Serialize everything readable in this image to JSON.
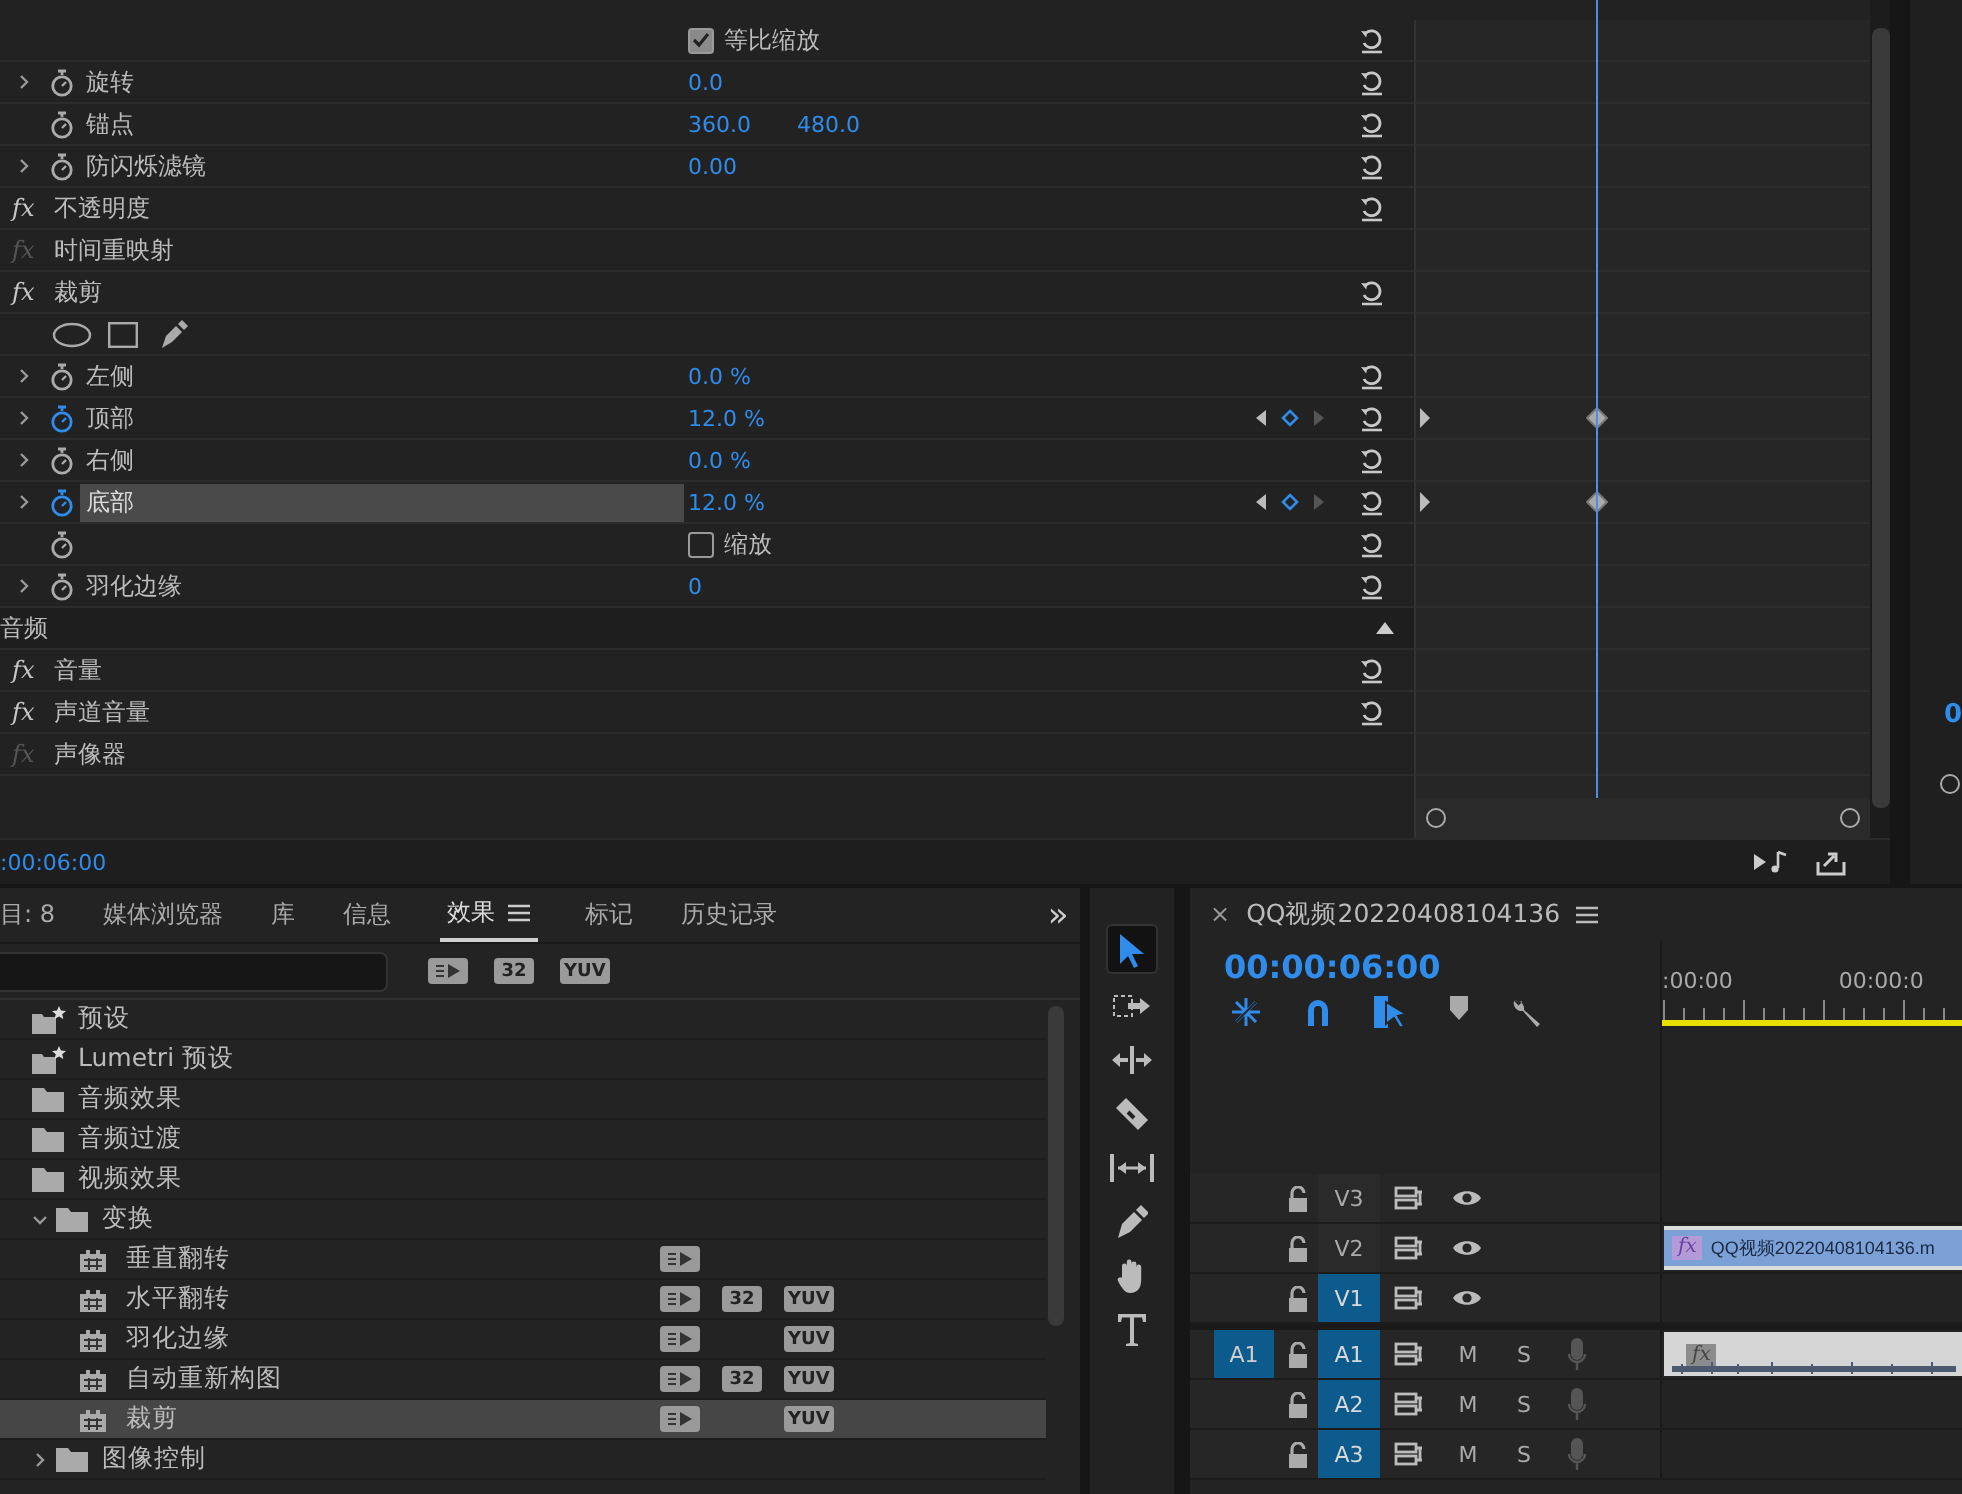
{
  "effect_controls": {
    "rows": [
      {
        "kind": "checkbox",
        "label": "等比缩放",
        "checked": true,
        "resettable": true
      },
      {
        "kind": "property",
        "label": "旋转",
        "values": [
          "0.0"
        ],
        "expanded": false,
        "animated": false,
        "keyframed": false,
        "selected": false,
        "resettable": true
      },
      {
        "kind": "property",
        "label": "锚点",
        "values": [
          "360.0",
          "480.0"
        ],
        "animated": false,
        "keyframed": false,
        "selected": false,
        "resettable": true
      },
      {
        "kind": "property",
        "label": "防闪烁滤镜",
        "values": [
          "0.00"
        ],
        "expanded": false,
        "animated": false,
        "keyframed": false,
        "selected": false,
        "resettable": true
      },
      {
        "kind": "effect",
        "icon_text": "fx",
        "label": "不透明度",
        "enabled": true,
        "resettable": true
      },
      {
        "kind": "effect",
        "icon_text": "fx",
        "label": "时间重映射",
        "enabled": false,
        "resettable": false
      },
      {
        "kind": "effect",
        "icon_text": "fx",
        "label": "裁剪",
        "enabled": true,
        "resettable": true
      },
      {
        "kind": "mask_tools"
      },
      {
        "kind": "property",
        "label": "左侧",
        "values": [
          "0.0 %"
        ],
        "expanded": false,
        "animated": false,
        "keyframed": false,
        "selected": false,
        "resettable": true
      },
      {
        "kind": "property",
        "label": "顶部",
        "values": [
          "12.0 %"
        ],
        "expanded": false,
        "animated": true,
        "keyframed": true,
        "selected": false,
        "resettable": true
      },
      {
        "kind": "property",
        "label": "右侧",
        "values": [
          "0.0 %"
        ],
        "expanded": false,
        "animated": false,
        "keyframed": false,
        "selected": false,
        "resettable": true
      },
      {
        "kind": "property",
        "label": "底部",
        "values": [
          "12.0 %"
        ],
        "expanded": false,
        "animated": true,
        "keyframed": true,
        "selected": true,
        "resettable": true
      },
      {
        "kind": "checkbox",
        "label": "缩放",
        "checked": false,
        "stopwatch": true,
        "resettable": true
      },
      {
        "kind": "property",
        "label": "羽化边缘",
        "values": [
          "0"
        ],
        "expanded": false,
        "animated": false,
        "keyframed": false,
        "selected": false,
        "resettable": true
      },
      {
        "kind": "section",
        "label": "音频",
        "expanded": true
      },
      {
        "kind": "effect",
        "icon_text": "fx",
        "label": "音量",
        "enabled": true,
        "resettable": true
      },
      {
        "kind": "effect",
        "icon_text": "fx",
        "label": "声道音量",
        "enabled": true,
        "resettable": true
      },
      {
        "kind": "effect",
        "icon_text": "fx",
        "label": "声像器",
        "enabled": false,
        "resettable": false
      }
    ],
    "timecode": ":00:06:00"
  },
  "program_monitor": {
    "timecode": "0"
  },
  "effects_panel": {
    "tabs": [
      {
        "label": "目: 8",
        "selected": false
      },
      {
        "label": "媒体浏览器",
        "selected": false
      },
      {
        "label": "库",
        "selected": false
      },
      {
        "label": "信息",
        "selected": false
      },
      {
        "label": "效果",
        "selected": true
      },
      {
        "label": "标记",
        "selected": false
      },
      {
        "label": "历史记录",
        "selected": false
      }
    ],
    "overflow": "»",
    "filters": [
      {
        "kind": "accelerated"
      },
      {
        "kind": "text",
        "label": "32"
      },
      {
        "kind": "text",
        "label": "YUV"
      }
    ],
    "tree": [
      {
        "kind": "preset",
        "label": "预设",
        "selected": false
      },
      {
        "kind": "preset",
        "label": "Lumetri 预设",
        "selected": false
      },
      {
        "kind": "folder",
        "label": "音频效果",
        "selected": false
      },
      {
        "kind": "folder",
        "label": "音频过渡",
        "selected": false
      },
      {
        "kind": "folder",
        "label": "视频效果",
        "selected": false,
        "expanded": true,
        "children": [
          {
            "kind": "folder",
            "label": "变换",
            "selected": false,
            "expanded": true,
            "children": [
              {
                "kind": "effect",
                "label": "垂直翻转",
                "selected": false,
                "accelerated": true
              },
              {
                "kind": "effect",
                "label": "水平翻转",
                "selected": false,
                "accelerated": true,
                "bit32": "32",
                "yuv": "YUV"
              },
              {
                "kind": "effect",
                "label": "羽化边缘",
                "selected": false,
                "accelerated": true,
                "yuv": "YUV"
              },
              {
                "kind": "effect",
                "label": "自动重新构图",
                "selected": false,
                "accelerated": true,
                "bit32": "32",
                "yuv": "YUV"
              },
              {
                "kind": "effect",
                "label": "裁剪",
                "selected": true,
                "accelerated": true,
                "yuv": "YUV"
              }
            ]
          },
          {
            "kind": "folder",
            "label": "图像控制",
            "selected": false,
            "expanded": false
          }
        ]
      }
    ]
  },
  "tools": [
    {
      "kind": "selection",
      "selected": true
    },
    {
      "kind": "track_select",
      "selected": false
    },
    {
      "kind": "ripple",
      "selected": false
    },
    {
      "kind": "razor",
      "selected": false
    },
    {
      "kind": "slip",
      "selected": false
    },
    {
      "kind": "pen",
      "selected": false
    },
    {
      "kind": "hand",
      "selected": false
    },
    {
      "kind": "type",
      "selected": false
    }
  ],
  "timeline": {
    "close": "×",
    "title": "QQ视频20220408104136",
    "timecode": "00:00:06:00",
    "controls": [
      {
        "kind": "nest",
        "on": true
      },
      {
        "kind": "snap",
        "on": true
      },
      {
        "kind": "linked",
        "on": true
      },
      {
        "kind": "marker"
      },
      {
        "kind": "settings"
      }
    ],
    "ruler": [
      ":00:00",
      "00:00:0"
    ],
    "video_tracks": [
      {
        "name": "V3",
        "targeted": false
      },
      {
        "name": "V2",
        "targeted": false,
        "clip": {
          "icon_text": "fx",
          "name": "QQ视频20220408104136.m"
        }
      },
      {
        "name": "V1",
        "targeted": true
      }
    ],
    "audio_tracks": [
      {
        "source": "A1",
        "name": "A1",
        "targeted": true,
        "mute": "M",
        "solo": "S",
        "clip": {
          "icon_text": "fx"
        }
      },
      {
        "name": "A2",
        "targeted": true,
        "mute": "M",
        "solo": "S"
      },
      {
        "name": "A3",
        "targeted": true,
        "mute": "M",
        "solo": "S"
      }
    ]
  }
}
